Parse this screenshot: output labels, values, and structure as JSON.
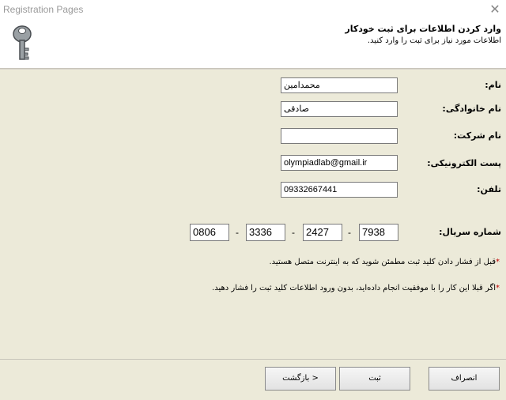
{
  "window": {
    "title": "Registration Pages",
    "close_glyph": "✕"
  },
  "header": {
    "title": "وارد کردن اطلاعات برای ثبت خودکار",
    "subtitle": "اطلاعات مورد نیاز برای ثبت را وارد کنید."
  },
  "form": {
    "name": {
      "label": "نام:",
      "value": "محمدامین"
    },
    "family": {
      "label": "نام خانوادگی:",
      "value": "صادقی"
    },
    "company": {
      "label": "نام شرکت:",
      "value": ""
    },
    "email": {
      "label": "پست الکترونیکی:",
      "value": "olympiadlab@gmail.ir"
    },
    "phone": {
      "label": "تلفن:",
      "value": "09332667441"
    },
    "serial": {
      "label": "شماره سریال:",
      "parts": [
        "0806",
        "3336",
        "2427",
        "7938"
      ],
      "separator": "-"
    }
  },
  "notes": [
    {
      "star": "*",
      "text": "قبل از فشار دادن کلید ثبت مطمئن شوید که به اینترنت متصل هستید."
    },
    {
      "star": "*",
      "text": "اگر قبلا این کار را با موفقیت انجام داده‌اید، بدون ورود اطلاعات کلید ثبت را فشار دهید."
    }
  ],
  "buttons": {
    "back": "بازگشت >",
    "register": "ثبت",
    "cancel": "انصراف"
  },
  "icons": {
    "header": "key-icon",
    "close": "close-icon"
  }
}
